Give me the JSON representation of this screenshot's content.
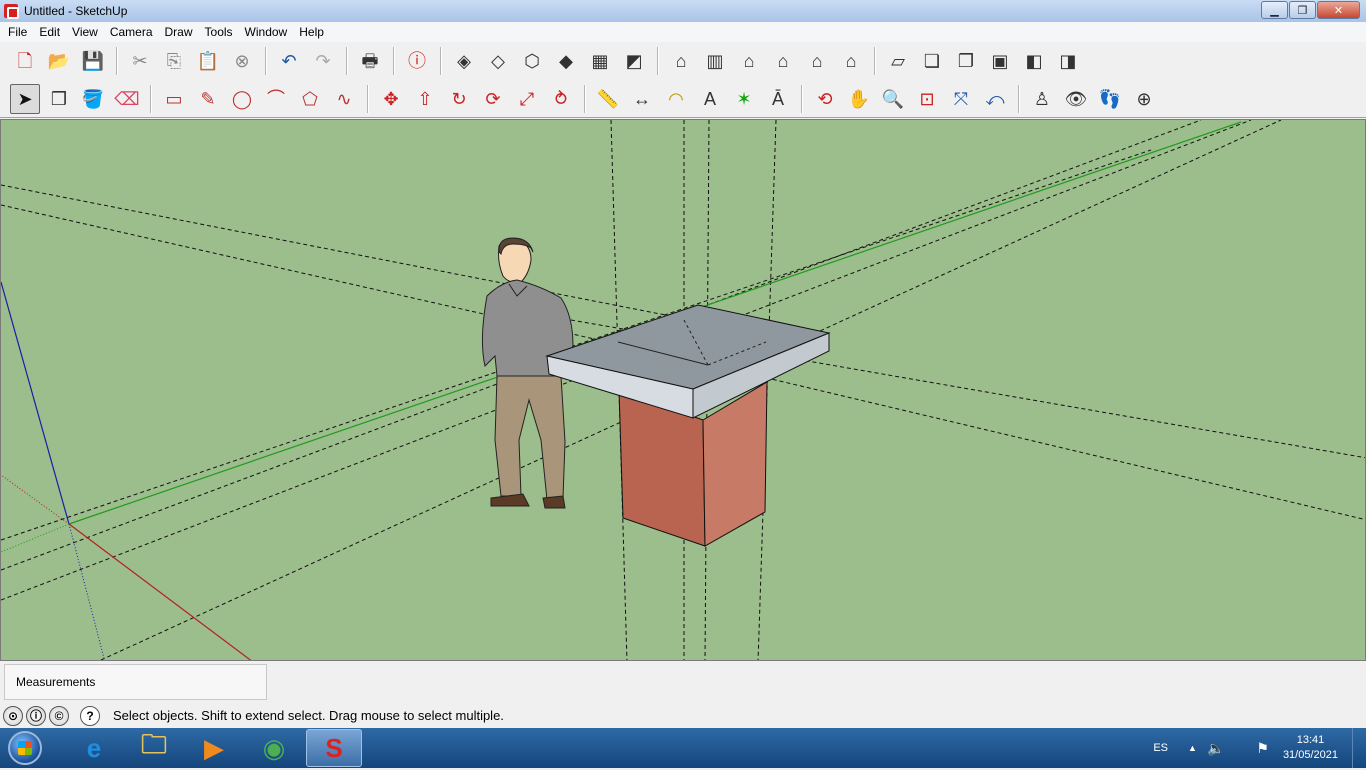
{
  "window": {
    "title": "Untitled - SketchUp",
    "minimize_icon": "minimize-icon",
    "maximize_icon": "maximize-icon",
    "close_icon": "close-icon"
  },
  "menu": [
    "File",
    "Edit",
    "View",
    "Camera",
    "Draw",
    "Tools",
    "Window",
    "Help"
  ],
  "toolbar_row1": [
    "new-file-icon",
    "open-file-icon",
    "save-icon",
    "|",
    "cut-icon",
    "copy-icon",
    "paste-icon",
    "erase-icon",
    "|",
    "undo-icon",
    "redo-icon",
    "|",
    "print-icon",
    "|",
    "model-info-icon",
    "|",
    "xray-icon",
    "wireframe-icon",
    "hidden-line-icon",
    "shaded-icon",
    "shaded-textures-icon",
    "monochrome-icon",
    "|",
    "iso-view-icon",
    "top-view-icon",
    "front-view-icon",
    "right-view-icon",
    "back-view-icon",
    "left-view-icon",
    "|",
    "layers-icon",
    "outliner-icon",
    "components-icon",
    "materials-icon",
    "styles-icon",
    "scenes-icon"
  ],
  "toolbar_row2": [
    "select-icon",
    "make-component-icon",
    "paint-bucket-icon",
    "eraser-icon",
    "|",
    "rectangle-icon",
    "line-icon",
    "circle-icon",
    "arc-icon",
    "polygon-icon",
    "freehand-icon",
    "|",
    "move-icon",
    "push-pull-icon",
    "rotate-icon",
    "follow-me-icon",
    "scale-icon",
    "offset-icon",
    "|",
    "tape-measure-icon",
    "dimension-icon",
    "protractor-icon",
    "text-icon",
    "axes-icon",
    "3d-text-icon",
    "|",
    "orbit-icon",
    "pan-icon",
    "zoom-icon",
    "zoom-window-icon",
    "zoom-extents-icon",
    "previous-view-icon",
    "|",
    "position-camera-icon",
    "look-around-icon",
    "walk-icon",
    "section-plane-icon"
  ],
  "colors": {
    "viewport_bg": "#9cbd8c",
    "slab_top": "#8f979f",
    "slab_front": "#d0d6dc",
    "brick": "#b45a48"
  },
  "measurements": {
    "label": "Measurements",
    "value": ""
  },
  "status": {
    "text": "Select objects. Shift to extend select. Drag mouse to select multiple.",
    "help_icon": "?"
  },
  "taskbar": {
    "apps": [
      "internet-explorer-icon",
      "file-explorer-icon",
      "media-player-icon",
      "chrome-icon",
      "sketchup-icon"
    ],
    "lang": "ES",
    "time": "13:41",
    "date": "31/05/2021"
  }
}
